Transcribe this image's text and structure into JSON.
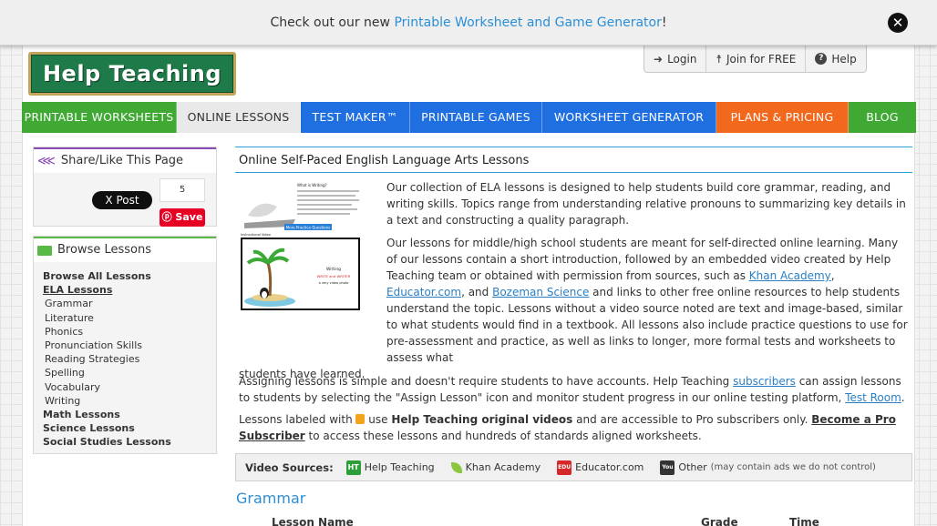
{
  "banner": {
    "prefix": "Check out our new ",
    "link": "Printable Worksheet and Game Generator",
    "suffix": "!"
  },
  "logo": {
    "text": "Help Teaching"
  },
  "account": {
    "login": "Login",
    "join": "Join for FREE",
    "help": "Help"
  },
  "nav": [
    {
      "label": "PRINTABLE WORKSHEETS",
      "color": "#3fa934"
    },
    {
      "label": "ONLINE LESSONS",
      "color": "#e6e6e6"
    },
    {
      "label": "TEST MAKER™",
      "color": "#1f6fe0"
    },
    {
      "label": "PRINTABLE GAMES",
      "color": "#1f6fe0"
    },
    {
      "label": "WORKSHEET GENERATOR",
      "color": "#1f6fe0"
    },
    {
      "label": "PLANS & PRICING",
      "color": "#f2681c"
    },
    {
      "label": "BLOG",
      "color": "#3fa934"
    }
  ],
  "share": {
    "title": "Share/Like This Page",
    "xpost": "X Post",
    "count": "5",
    "pin": "Save"
  },
  "browse": {
    "title": "Browse Lessons",
    "items": [
      {
        "label": "Browse All Lessons",
        "style": "bold"
      },
      {
        "label": "ELA Lessons",
        "style": "bold-ul"
      },
      {
        "label": "Grammar",
        "style": "sub"
      },
      {
        "label": "Literature",
        "style": "sub"
      },
      {
        "label": "Phonics",
        "style": "sub"
      },
      {
        "label": "Pronunciation Skills",
        "style": "sub"
      },
      {
        "label": "Reading Strategies",
        "style": "sub"
      },
      {
        "label": "Spelling",
        "style": "sub"
      },
      {
        "label": "Vocabulary",
        "style": "sub"
      },
      {
        "label": "Writing",
        "style": "sub"
      },
      {
        "label": "Math Lessons",
        "style": "bold"
      },
      {
        "label": "Science Lessons",
        "style": "bold"
      },
      {
        "label": "Social Studies Lessons",
        "style": "bold"
      }
    ]
  },
  "main": {
    "title": "Online Self-Paced English Language Arts Lessons",
    "p1": "Our collection of ELA lessons is designed to help students build core grammar, reading, and writing skills. Topics range from understanding relative pronouns to summarizing key details in a text and constructing a quality paragraph.",
    "p2a": "Our lessons for middle/high school students are meant for self-directed online learning. Many of our lessons contain a short introduction, followed by an embedded video created by Help Teaching team or obtained with permission from sources, such as ",
    "p2_khan": "Khan Academy",
    "p2_comma": ", ",
    "p2_educator": "Educator.com",
    "p2_and": ", and ",
    "p2_bozeman": "Bozeman Science",
    "p2b": " and links to other free online resources to help students understand the topic. Lessons without a video source noted are text and image-based, similar to what students would find in a textbook. All lessons also include practice questions to use for pre-assessment and practice, as well as links to longer, more formal tests and worksheets to assess what",
    "p2c": "students have learned.",
    "p3a": "Assigning lessons is simple and doesn't require students to have accounts. Help Teaching ",
    "p3_subscribers": "subscribers",
    "p3b": " can assign lessons to students by selecting the \"Assign Lesson\" icon and monitor student progress in our online testing platform, ",
    "p3_testroom": "Test Room",
    "p3c": ".",
    "p4a": "Lessons labeled with ",
    "p4b": " use ",
    "p4_bold": "Help Teaching original videos",
    "p4c": " and are accessible to Pro subscribers only. ",
    "p4_link": "Become a Pro Subscriber",
    "p4d": " to access these lessons and hundreds of standards aligned worksheets.",
    "thumb": {
      "heading": "What is Writing?",
      "button": "More Practice Questions",
      "video_title": "Instructional Video",
      "video_line1": "Writing",
      "video_line2": "WRITE and WRITER",
      "video_line3": "a very video photo"
    }
  },
  "video_sources": {
    "label": "Video Sources:",
    "sources": [
      {
        "badge": "HT",
        "label": "Help Teaching",
        "color": "#2e9e3a"
      },
      {
        "badge": "",
        "label": "Khan Academy",
        "color": "#8cc63f"
      },
      {
        "badge": "EDU",
        "label": "Educator.com",
        "color": "#d62828"
      },
      {
        "badge": "You",
        "label": "Other",
        "color": "#333333"
      }
    ],
    "note": "(may contain ads we do not control)"
  },
  "grammar": {
    "title": "Grammar",
    "col_lesson": "Lesson Name",
    "col_grade": "Grade",
    "col_time": "Time"
  }
}
